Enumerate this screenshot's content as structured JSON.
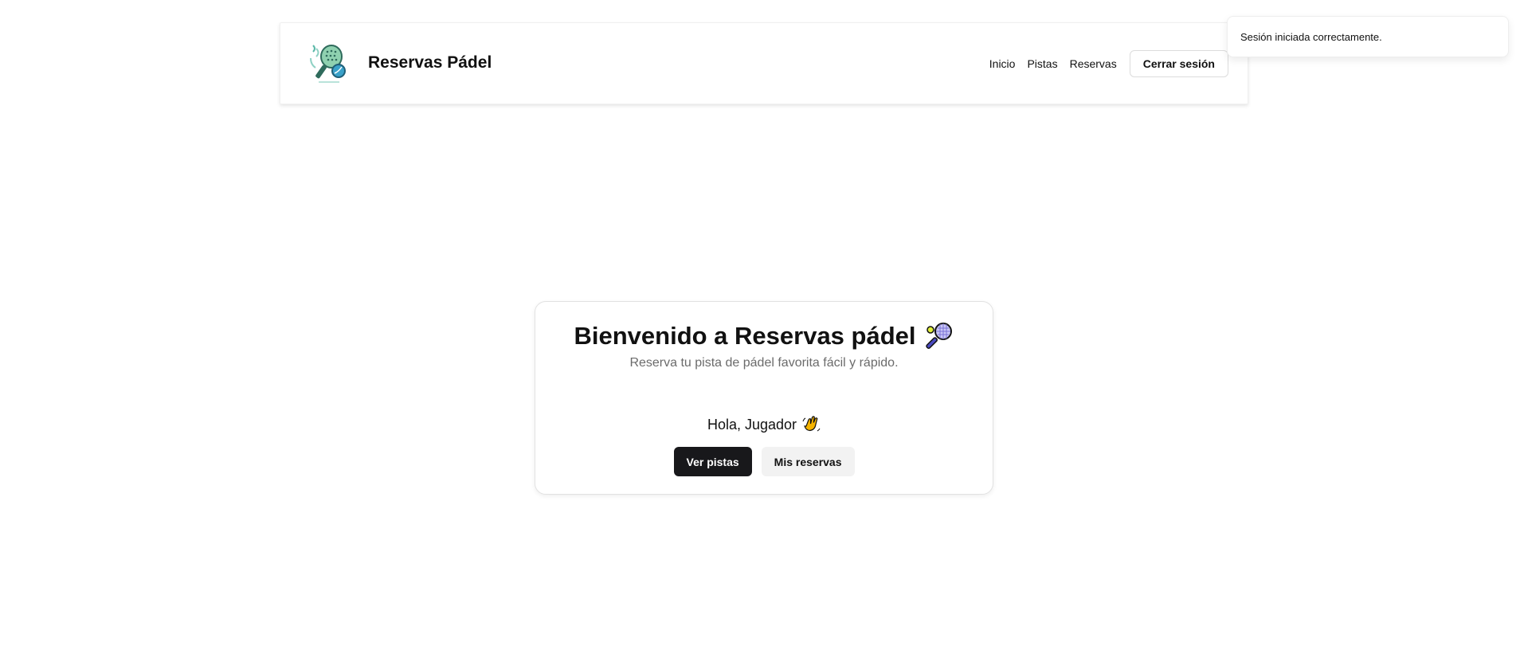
{
  "header": {
    "logo": "padel-racket-logo-icon",
    "title": "Reservas Pádel",
    "nav": [
      {
        "label": "Inicio"
      },
      {
        "label": "Pistas"
      },
      {
        "label": "Reservas"
      }
    ],
    "logout_label": "Cerrar sesión"
  },
  "toast": {
    "message": "Sesión iniciada correctamente."
  },
  "welcome": {
    "title": "Bienvenido a Reservas pádel",
    "title_icon": "racket-emoji-icon",
    "subtitle": "Reserva tu pista de pádel favorita fácil y rápido.",
    "greeting": "Hola, Jugador",
    "greeting_icon": "waving-hand-icon",
    "primary_button": "Ver pistas",
    "secondary_button": "Mis reservas"
  },
  "colors": {
    "primary_button_bg": "#18181b",
    "secondary_button_bg": "#f2f2f2",
    "logo_accent": "#5bb8a8"
  }
}
